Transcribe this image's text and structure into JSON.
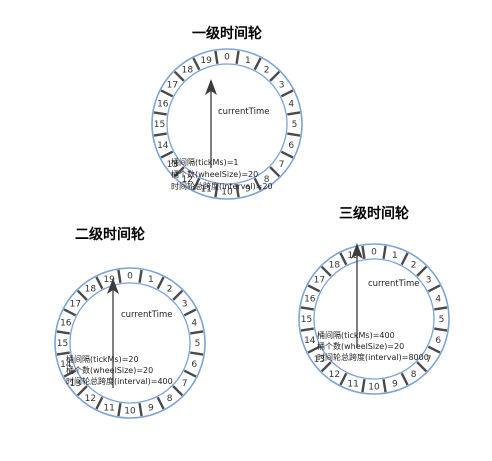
{
  "wheels": [
    {
      "title": "一级时间轮",
      "slots": [
        "0",
        "1",
        "2",
        "3",
        "4",
        "5",
        "6",
        "7",
        "8",
        "9",
        "10",
        "11",
        "12",
        "13",
        "14",
        "15",
        "16",
        "17",
        "18",
        "19"
      ],
      "pointer_label": "currentTime",
      "info": [
        "桶间隔(tickMs)=1",
        "桶个数(wheelSize)=20",
        "时间轮总跨度(interval)=20"
      ]
    },
    {
      "title": "二级时间轮",
      "slots": [
        "0",
        "1",
        "2",
        "3",
        "4",
        "5",
        "6",
        "7",
        "8",
        "9",
        "10",
        "11",
        "12",
        "13",
        "14",
        "15",
        "16",
        "17",
        "18",
        "19"
      ],
      "pointer_label": "currentTime",
      "info": [
        "桶间隔(tickMs)=20",
        "桶个数(wheelSize)=20",
        "时间轮总跨度(interval)=400"
      ]
    },
    {
      "title": "三级时间轮",
      "slots": [
        "0",
        "1",
        "2",
        "3",
        "4",
        "5",
        "6",
        "7",
        "8",
        "9",
        "10",
        "11",
        "12",
        "13",
        "14",
        "15",
        "16",
        "17",
        "18",
        "19"
      ],
      "pointer_label": "currentTime",
      "info": [
        "桶间隔(tickMs)=400",
        "桶个数(wheelSize)=20",
        "时间轮总跨度(interval)=8000"
      ]
    }
  ],
  "colors": {
    "ring": "#7ba3d6",
    "divider": "#4a4a4a",
    "pointer": "#3c3c3c",
    "text": "#222222"
  }
}
